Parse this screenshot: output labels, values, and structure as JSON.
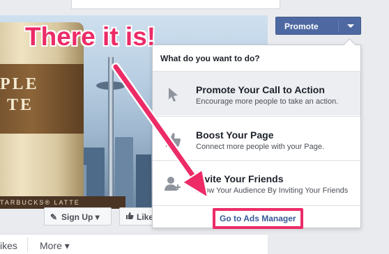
{
  "annotation": {
    "text": "There it is!",
    "color": "#ec2b67"
  },
  "cover": {
    "cup_text_line1": "PLE",
    "cup_text_line2": "TE",
    "cup_bottom_text": "TARBUCKS® LATTE"
  },
  "cover_buttons": {
    "signup": "Sign Up ▾",
    "like": "Like"
  },
  "tabs": {
    "likes": "ikes",
    "more": "More ▾"
  },
  "promote": {
    "label": "Promote",
    "color": "#4e69a2"
  },
  "dropdown": {
    "header": "What do you want to do?",
    "items": [
      {
        "title": "Promote Your Call to Action",
        "desc": "Encourage more people to take an action.",
        "icon": "cursor-icon"
      },
      {
        "title": "Boost Your Page",
        "desc": "Connect more people with your Page.",
        "icon": "thumbs-up-icon"
      },
      {
        "title": "Invite Your Friends",
        "desc": "Grow Your Audience By Inviting Your Friends",
        "icon": "add-friend-icon"
      }
    ],
    "footer_link": "Go to Ads Manager"
  }
}
